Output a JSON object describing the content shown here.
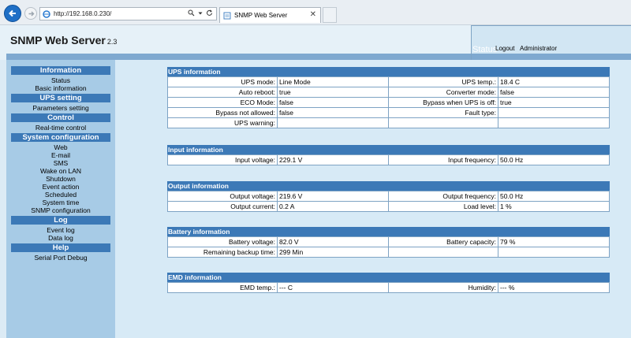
{
  "browser": {
    "url": "http://192.168.0.230/",
    "tab_title": "SNMP Web Server"
  },
  "header": {
    "title": "SNMP Web Server",
    "version": "2.3",
    "status_label": "Status",
    "logout_label": "Logout",
    "user_label": "Administrator"
  },
  "sidebar": {
    "sections": [
      {
        "title": "Information",
        "items": [
          "Status",
          "Basic information"
        ]
      },
      {
        "title": "UPS setting",
        "items": [
          "Parameters setting"
        ]
      },
      {
        "title": "Control",
        "items": [
          "Real-time control"
        ]
      },
      {
        "title": "System configuration",
        "items": [
          "Web",
          "E-mail",
          "SMS",
          "Wake on LAN",
          "Shutdown",
          "Event action",
          "Scheduled",
          "System time",
          "SNMP configuration"
        ]
      },
      {
        "title": "Log",
        "items": [
          "Event log",
          "Data log"
        ]
      },
      {
        "title": "Help",
        "items": [
          "Serial Port Debug"
        ]
      }
    ]
  },
  "sections": {
    "ups": {
      "title": "UPS information",
      "rows": [
        {
          "l1": "UPS mode:",
          "v1": "Line Mode",
          "l2": "UPS temp.:",
          "v2": "18.4 C"
        },
        {
          "l1": "Auto reboot:",
          "v1": "true",
          "l2": "Converter mode:",
          "v2": "false"
        },
        {
          "l1": "ECO Mode:",
          "v1": "false",
          "l2": "Bypass when UPS is off:",
          "v2": "true"
        },
        {
          "l1": "Bypass not allowed:",
          "v1": "false",
          "l2": "Fault type:",
          "v2": ""
        },
        {
          "l1": "UPS warning:",
          "v1": "",
          "l2": "",
          "v2": ""
        }
      ]
    },
    "input": {
      "title": "Input information",
      "rows": [
        {
          "l1": "Input voltage:",
          "v1": "229.1 V",
          "l2": "Input frequency:",
          "v2": "50.0 Hz"
        }
      ]
    },
    "output": {
      "title": "Output information",
      "rows": [
        {
          "l1": "Output voltage:",
          "v1": "219.6 V",
          "l2": "Output frequency:",
          "v2": "50.0 Hz"
        },
        {
          "l1": "Output current:",
          "v1": "0.2 A",
          "l2": "Load level:",
          "v2": "1 %"
        }
      ]
    },
    "battery": {
      "title": "Battery information",
      "rows": [
        {
          "l1": "Battery voltage:",
          "v1": "82.0 V",
          "l2": "Battery capacity:",
          "v2": "79 %"
        },
        {
          "l1": "Remaining backup time:",
          "v1": "299 Min",
          "l2": "",
          "v2": ""
        }
      ]
    },
    "emd": {
      "title": "EMD information",
      "rows": [
        {
          "l1": "EMD temp.:",
          "v1": "--- C",
          "l2": "Humidity:",
          "v2": "--- %"
        }
      ]
    }
  }
}
